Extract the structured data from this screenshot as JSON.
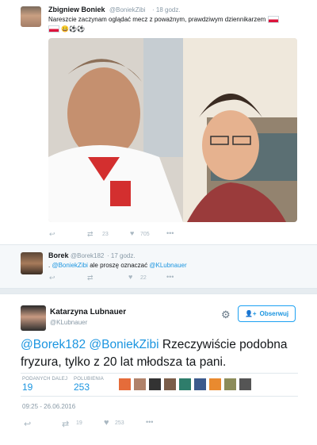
{
  "tweet1": {
    "name": "Zbigniew Boniek",
    "handle": "@BoniekZibi",
    "time": "· 18 godz.",
    "text": "Nareszcie zaczynam oglądać mecz z poważnym, prawdziwym dziennikarzem",
    "emoji": "😀⚽⚽ ",
    "retweets": "23",
    "likes": "705",
    "flag_color": "#dc143c"
  },
  "tweet2": {
    "name": "Borek",
    "handle": "@Borek182",
    "time": "· 17 godz.",
    "prefix": ".",
    "mention1": "@BoniekZibi",
    "mid": "ale proszę oznaczać",
    "mention2": "@KLubnauer",
    "likes": "22"
  },
  "tweet3": {
    "name": "Katarzyna Lubnauer",
    "handle": "@KLubnauer",
    "follow_label": "Obserwuj",
    "mention1": "@Borek182",
    "mention2": "@BoniekZibi",
    "text": "Rzeczywiście podobna fryzura, tylko z 20 lat młodsza ta pani.",
    "retweets_label": "PODANYCH DALEJ",
    "retweets": "19",
    "likes_label": "POLUBIENIA",
    "likes": "253",
    "timestamp": "09:25 - 26.06.2016",
    "action_retweets": "19",
    "action_likes": "253"
  },
  "colors": {
    "link": "#1b95e0",
    "background": "#e6ecf0",
    "like_heart": "#aab8c2"
  }
}
